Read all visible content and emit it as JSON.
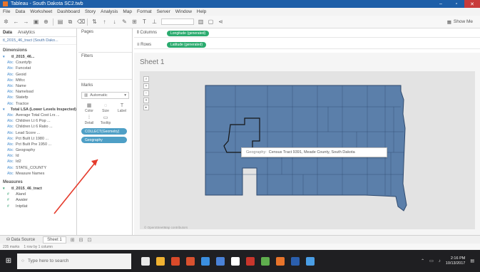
{
  "window": {
    "title": "Tableau - South Dakota SC2.twb"
  },
  "menubar": {
    "items": [
      "File",
      "Data",
      "Worksheet",
      "Dashboard",
      "Story",
      "Analysis",
      "Map",
      "Format",
      "Server",
      "Window",
      "Help"
    ]
  },
  "toolbar": {
    "show_me_label": "Show Me"
  },
  "datapane": {
    "tab_data": "Data",
    "tab_analytics": "Analytics",
    "source_name": "tl_2015_46_tract (South Dako...",
    "dimensions_header": "Dimensions",
    "measures_header": "Measures",
    "dimensions": [
      {
        "label": "tl_2015_46...",
        "group": true
      },
      {
        "label": "Countyfp",
        "group": false
      },
      {
        "label": "Funcstat",
        "group": false
      },
      {
        "label": "Geoid",
        "group": false
      },
      {
        "label": "Mtfcc",
        "group": false
      },
      {
        "label": "Name",
        "group": false
      },
      {
        "label": "Namelsad",
        "group": false
      },
      {
        "label": "Statefp",
        "group": false
      },
      {
        "label": "Tractce",
        "group": false
      },
      {
        "label": "Total LSA (Lower Levels Inspected)",
        "group": true
      },
      {
        "label": "Average Total Cost Lrs ...",
        "group": false
      },
      {
        "label": "Children Lt 6 Pop ...",
        "group": false
      },
      {
        "label": "Children Lt 6 Ratio ...",
        "group": false
      },
      {
        "label": "Lead Score ...",
        "group": false
      },
      {
        "label": "Pct Built Lt 1980 ...",
        "group": false
      },
      {
        "label": "Pct Built Pre 1950 ...",
        "group": false
      },
      {
        "label": "Geography",
        "group": false
      },
      {
        "label": "Id",
        "group": false
      },
      {
        "label": "Id2",
        "group": false
      },
      {
        "label": "STATE_COUNTY",
        "group": false
      },
      {
        "label": "Measure Names",
        "group": false
      }
    ],
    "measures": [
      {
        "label": "tl_2015_46_tract",
        "group": true
      },
      {
        "label": "Aland",
        "group": false
      },
      {
        "label": "Awater",
        "group": false
      },
      {
        "label": "Intptlat",
        "group": false
      }
    ]
  },
  "shelves": {
    "pages_label": "Pages",
    "filters_label": "Filters",
    "marks_label": "Marks",
    "marks_type": "Automatic",
    "mark_buttons": [
      {
        "label": "Color",
        "glyph": "▦"
      },
      {
        "label": "Size",
        "glyph": "◌"
      },
      {
        "label": "Label",
        "glyph": "T"
      },
      {
        "label": "Detail",
        "glyph": "⁞"
      },
      {
        "label": "Tooltip",
        "glyph": "▭"
      }
    ],
    "mark_pills": [
      "COLLECT(Geometry)",
      "Geography"
    ],
    "columns_label": "Columns",
    "rows_label": "Rows",
    "columns_pill": "Longitude (generated)",
    "rows_pill": "Latitude (generated)"
  },
  "sheet": {
    "title": "Sheet 1",
    "map_attribution": "© OpenStreetMap contributors",
    "tooltip_key": "Geography:",
    "tooltip_value": "Census Tract 9391, Meade County, South Dakota",
    "map_fill": "#5b7faa",
    "map_stroke": "#2f4a6e"
  },
  "tabs": {
    "datasource_label": "Data Source",
    "sheet_label": "Sheet 1"
  },
  "status": {
    "marks": "235 marks",
    "rows_cols": "1 row by 1 column"
  },
  "taskbar": {
    "search_placeholder": "Type here to search",
    "time": "2:16 PM",
    "date": "10/13/2017",
    "app_colors": [
      "#e8e8e8",
      "#f0b232",
      "#d94a2a",
      "#d9512f",
      "#3b8fe0",
      "#4a82d8",
      "#ffffff",
      "#c9362c",
      "#5fae4e",
      "#e8742b",
      "#2b5fae",
      "#4a9ee6"
    ]
  }
}
